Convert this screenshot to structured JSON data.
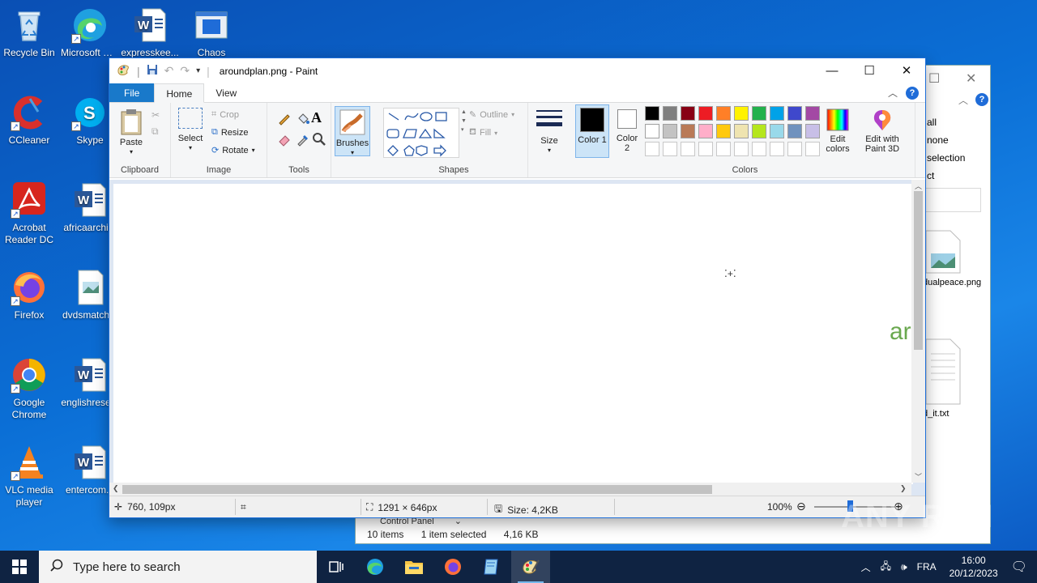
{
  "desktop": {
    "icons": [
      {
        "label": "Recycle Bin"
      },
      {
        "label": "Microsoft Edge"
      },
      {
        "label": "expresskee..."
      },
      {
        "label": "Chaos"
      },
      {
        "label": "CCleaner"
      },
      {
        "label": "Skype"
      },
      {
        "label": "Acrobat Reader DC"
      },
      {
        "label": "africaarchi..."
      },
      {
        "label": "Firefox"
      },
      {
        "label": "dvdsmatch..."
      },
      {
        "label": "Google Chrome"
      },
      {
        "label": "englishrese..."
      },
      {
        "label": "VLC media player"
      },
      {
        "label": "entercom..."
      }
    ]
  },
  "explorer": {
    "ribbon_items": [
      "all",
      "none",
      "selection",
      "ct"
    ],
    "files": [
      {
        "label": "dualpeace.png"
      },
      {
        "label": "d_it.txt"
      }
    ],
    "address": "Control Panel",
    "status_count": "10 items",
    "status_selected": "1 item selected",
    "status_size": "4,16 KB"
  },
  "paint": {
    "title": "aroundplan.png - Paint",
    "tabs": {
      "file": "File",
      "home": "Home",
      "view": "View"
    },
    "clipboard": {
      "paste": "Paste",
      "label": "Clipboard"
    },
    "image": {
      "select": "Select",
      "crop": "Crop",
      "resize": "Resize",
      "rotate": "Rotate",
      "label": "Image"
    },
    "tools": {
      "label": "Tools"
    },
    "brushes": {
      "label": "Brushes"
    },
    "shapes": {
      "outline": "Outline",
      "fill": "Fill",
      "label": "Shapes"
    },
    "size": {
      "label": "Size"
    },
    "colors": {
      "color1": "Color 1",
      "color2": "Color 2",
      "edit_colors": "Edit colors",
      "edit_paint3d": "Edit with Paint 3D",
      "label": "Colors",
      "color1_value": "#000000",
      "color2_value": "#ffffff",
      "palette_row1": [
        "#000000",
        "#7f7f7f",
        "#880015",
        "#ed1c24",
        "#ff7f27",
        "#fff200",
        "#22b14c",
        "#00a2e8",
        "#3f48cc",
        "#a349a4"
      ],
      "palette_row2": [
        "#ffffff",
        "#c3c3c3",
        "#b97a57",
        "#ffaec9",
        "#ffc90e",
        "#efe4b0",
        "#b5e61d",
        "#99d9ea",
        "#7092be",
        "#c8bfe7"
      ]
    },
    "canvas_text": "ar",
    "status": {
      "position": "760, 109px",
      "dimensions": "1291 × 646px",
      "size": "Size: 4,2KB",
      "zoom": "100%"
    }
  },
  "taskbar": {
    "search_placeholder": "Type here to search",
    "language": "FRA",
    "time": "16:00",
    "date": "20/12/2023"
  },
  "watermark": "ANY RUN"
}
